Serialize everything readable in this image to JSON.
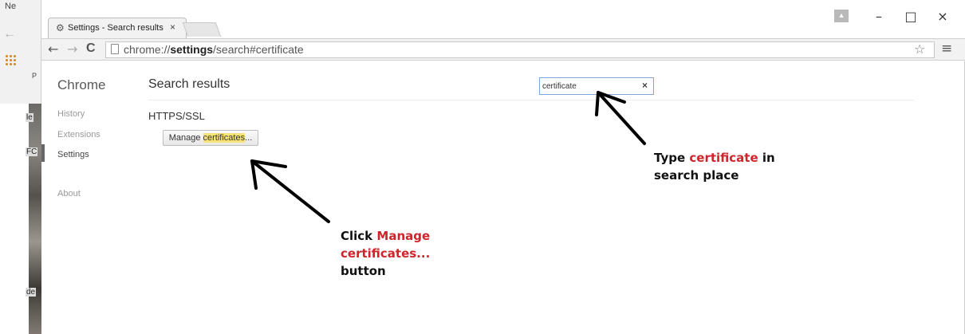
{
  "background": {
    "title_fragment": "Ne",
    "side_texts": [
      "le",
      "FC",
      "de"
    ],
    "p_fragment": "P"
  },
  "tab": {
    "title": "Settings - Search results",
    "close": "×"
  },
  "window_controls": {
    "minimize": "–",
    "maximize": "□",
    "close": "×"
  },
  "toolbar": {
    "back": "←",
    "forward": "→",
    "reload": "C",
    "url_prefix": "chrome://",
    "url_bold": "settings",
    "url_suffix": "/search#certificate",
    "star": "☆",
    "menu": "≡"
  },
  "sidebar": {
    "title": "Chrome",
    "items": [
      {
        "label": "History",
        "active": false
      },
      {
        "label": "Extensions",
        "active": false
      },
      {
        "label": "Settings",
        "active": true
      },
      {
        "label": "About",
        "active": false
      }
    ]
  },
  "main": {
    "title": "Search results",
    "section": "HTTPS/SSL",
    "button_prefix": "Manage ",
    "button_highlight": "certificates",
    "button_suffix": "..."
  },
  "search": {
    "value": "certificate",
    "clear": "×"
  },
  "annotations": {
    "type": {
      "line1_prefix": "Type ",
      "line1_red": "certificate",
      "line1_suffix": " in",
      "line2": "search place"
    },
    "click": {
      "line1_prefix": "Click ",
      "line1_red": "Manage",
      "line2_red": "certificates...",
      "line3": "button"
    }
  },
  "colors": {
    "annotation_red": "#d0242b",
    "highlight": "#f7e479",
    "search_border": "#7fa7dd"
  }
}
